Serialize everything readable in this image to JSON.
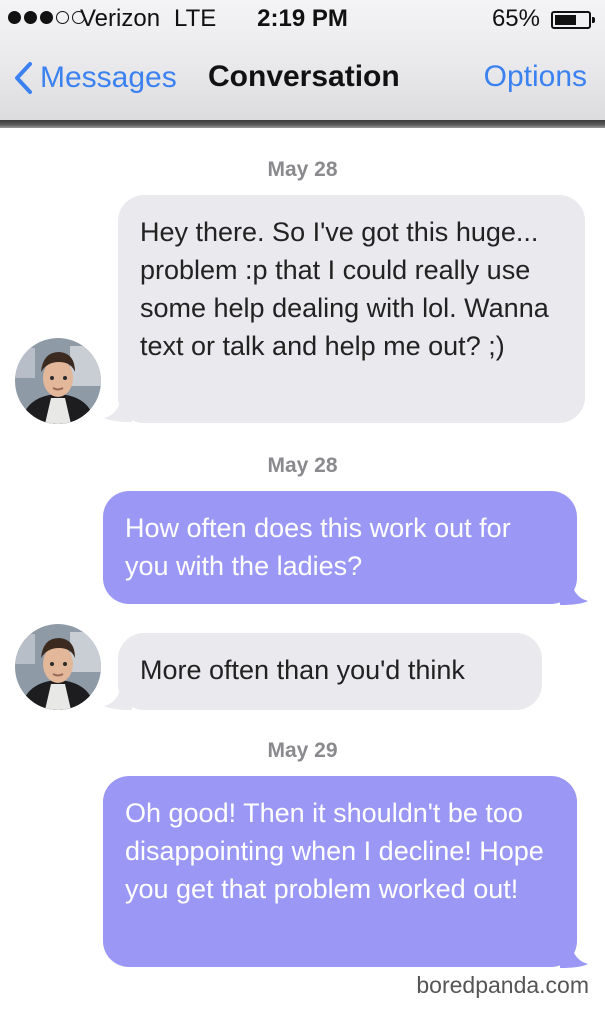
{
  "status_bar": {
    "carrier": "Verizon",
    "network": "LTE",
    "time": "2:19 PM",
    "battery_percent_text": "65%",
    "battery_level": 0.65,
    "signal_bars_filled": 3,
    "signal_bars_total": 5
  },
  "nav": {
    "back_label": "Messages",
    "title": "Conversation",
    "options_label": "Options"
  },
  "colors": {
    "accent_blue": "#3b82f0",
    "outgoing_bubble": "#9b97f5",
    "incoming_bubble": "#e9e9ee",
    "date_text": "#8a8a8e"
  },
  "messages": [
    {
      "date": "May 28",
      "direction": "incoming",
      "text": "Hey there. So I've got this huge... problem :p that I could really use some help dealing with lol. Wanna text or talk and help me out? ;)"
    },
    {
      "date": "May 28",
      "direction": "outgoing",
      "text": "How often does this work out for you with the ladies?"
    },
    {
      "direction": "incoming",
      "text": "More often than you'd think"
    },
    {
      "date": "May 29",
      "direction": "outgoing",
      "text": "Oh good! Then it shouldn't be too disappointing when I decline! Hope you get that problem worked out!"
    }
  ],
  "watermark": "boredpanda.com"
}
